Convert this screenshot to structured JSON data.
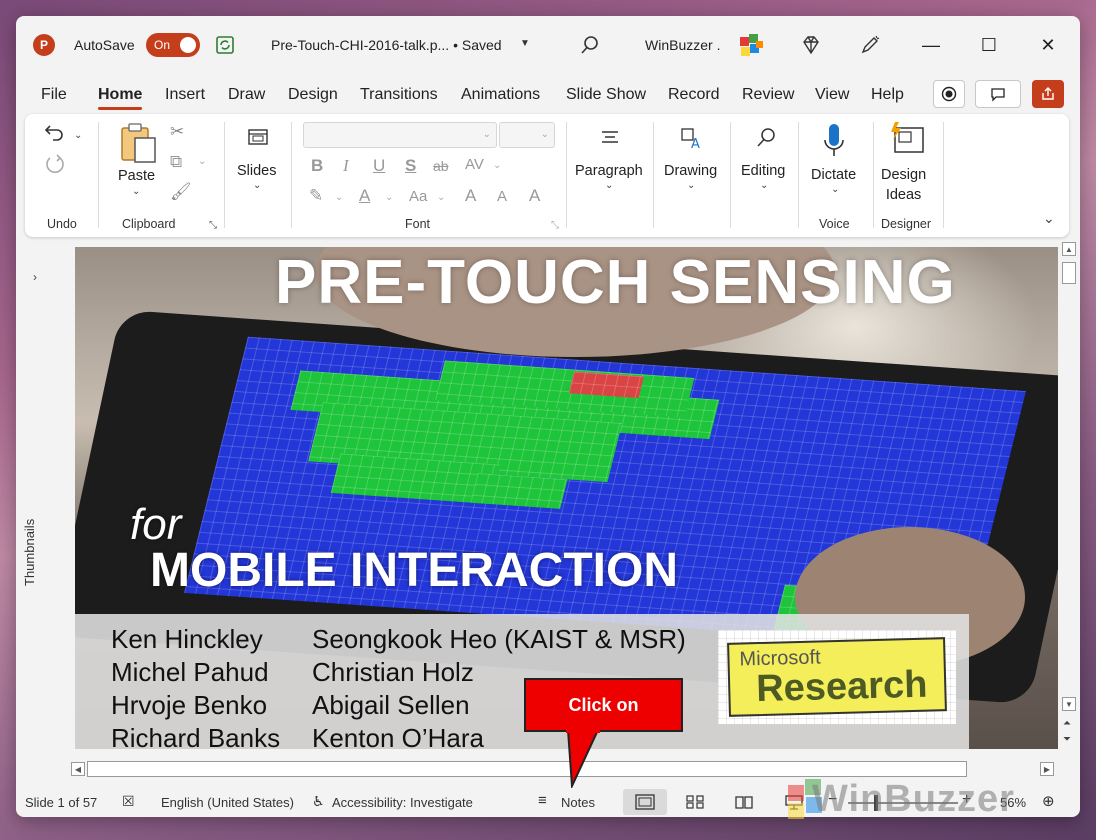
{
  "titlebar": {
    "app_logo": "P",
    "autosave_label": "AutoSave",
    "autosave_state": "On",
    "filename": "Pre-Touch-CHI-2016-talk.p... • Saved",
    "username": "WinBuzzer ."
  },
  "tabs": [
    "File",
    "Home",
    "Insert",
    "Draw",
    "Design",
    "Transitions",
    "Animations",
    "Slide Show",
    "Record",
    "Review",
    "View",
    "Help"
  ],
  "ribbon": {
    "undo_group": "Undo",
    "paste_label": "Paste",
    "clipboard_group": "Clipboard",
    "slides_label": "Slides",
    "font_group": "Font",
    "paragraph_label": "Paragraph",
    "drawing_label": "Drawing",
    "editing_label": "Editing",
    "dictate_label": "Dictate",
    "voice_group": "Voice",
    "design_ideas_label": "Design\nIdeas",
    "designer_group": "Designer",
    "font_buttons": [
      "B",
      "I",
      "U",
      "S",
      "ab",
      "AV",
      "A",
      "A",
      "Aa",
      "A",
      "A",
      "A"
    ]
  },
  "thumbnails_label": "Thumbnails",
  "slide": {
    "title": "PRE-TOUCH SENSING",
    "for": "for",
    "subtitle": "MOBILE INTERACTION",
    "authors_left": [
      "Ken Hinckley",
      "Michel Pahud",
      "Hrvoje Benko",
      "Richard Banks"
    ],
    "authors_right": [
      "Seongkook Heo (KAIST & MSR)",
      "Christian Holz",
      "Abigail Sellen",
      "Kenton O’Hara"
    ],
    "logo_line1": "Microsoft",
    "logo_line2": "Research"
  },
  "callout": "Click on",
  "statusbar": {
    "slide_count": "Slide 1 of 57",
    "language": "English (United States)",
    "accessibility": "Accessibility: Investigate",
    "notes": "Notes",
    "zoom": "56%"
  },
  "watermark": "WinBuzzer",
  "colors": {
    "accent": "#c43e1c",
    "callout": "#ee0000"
  }
}
